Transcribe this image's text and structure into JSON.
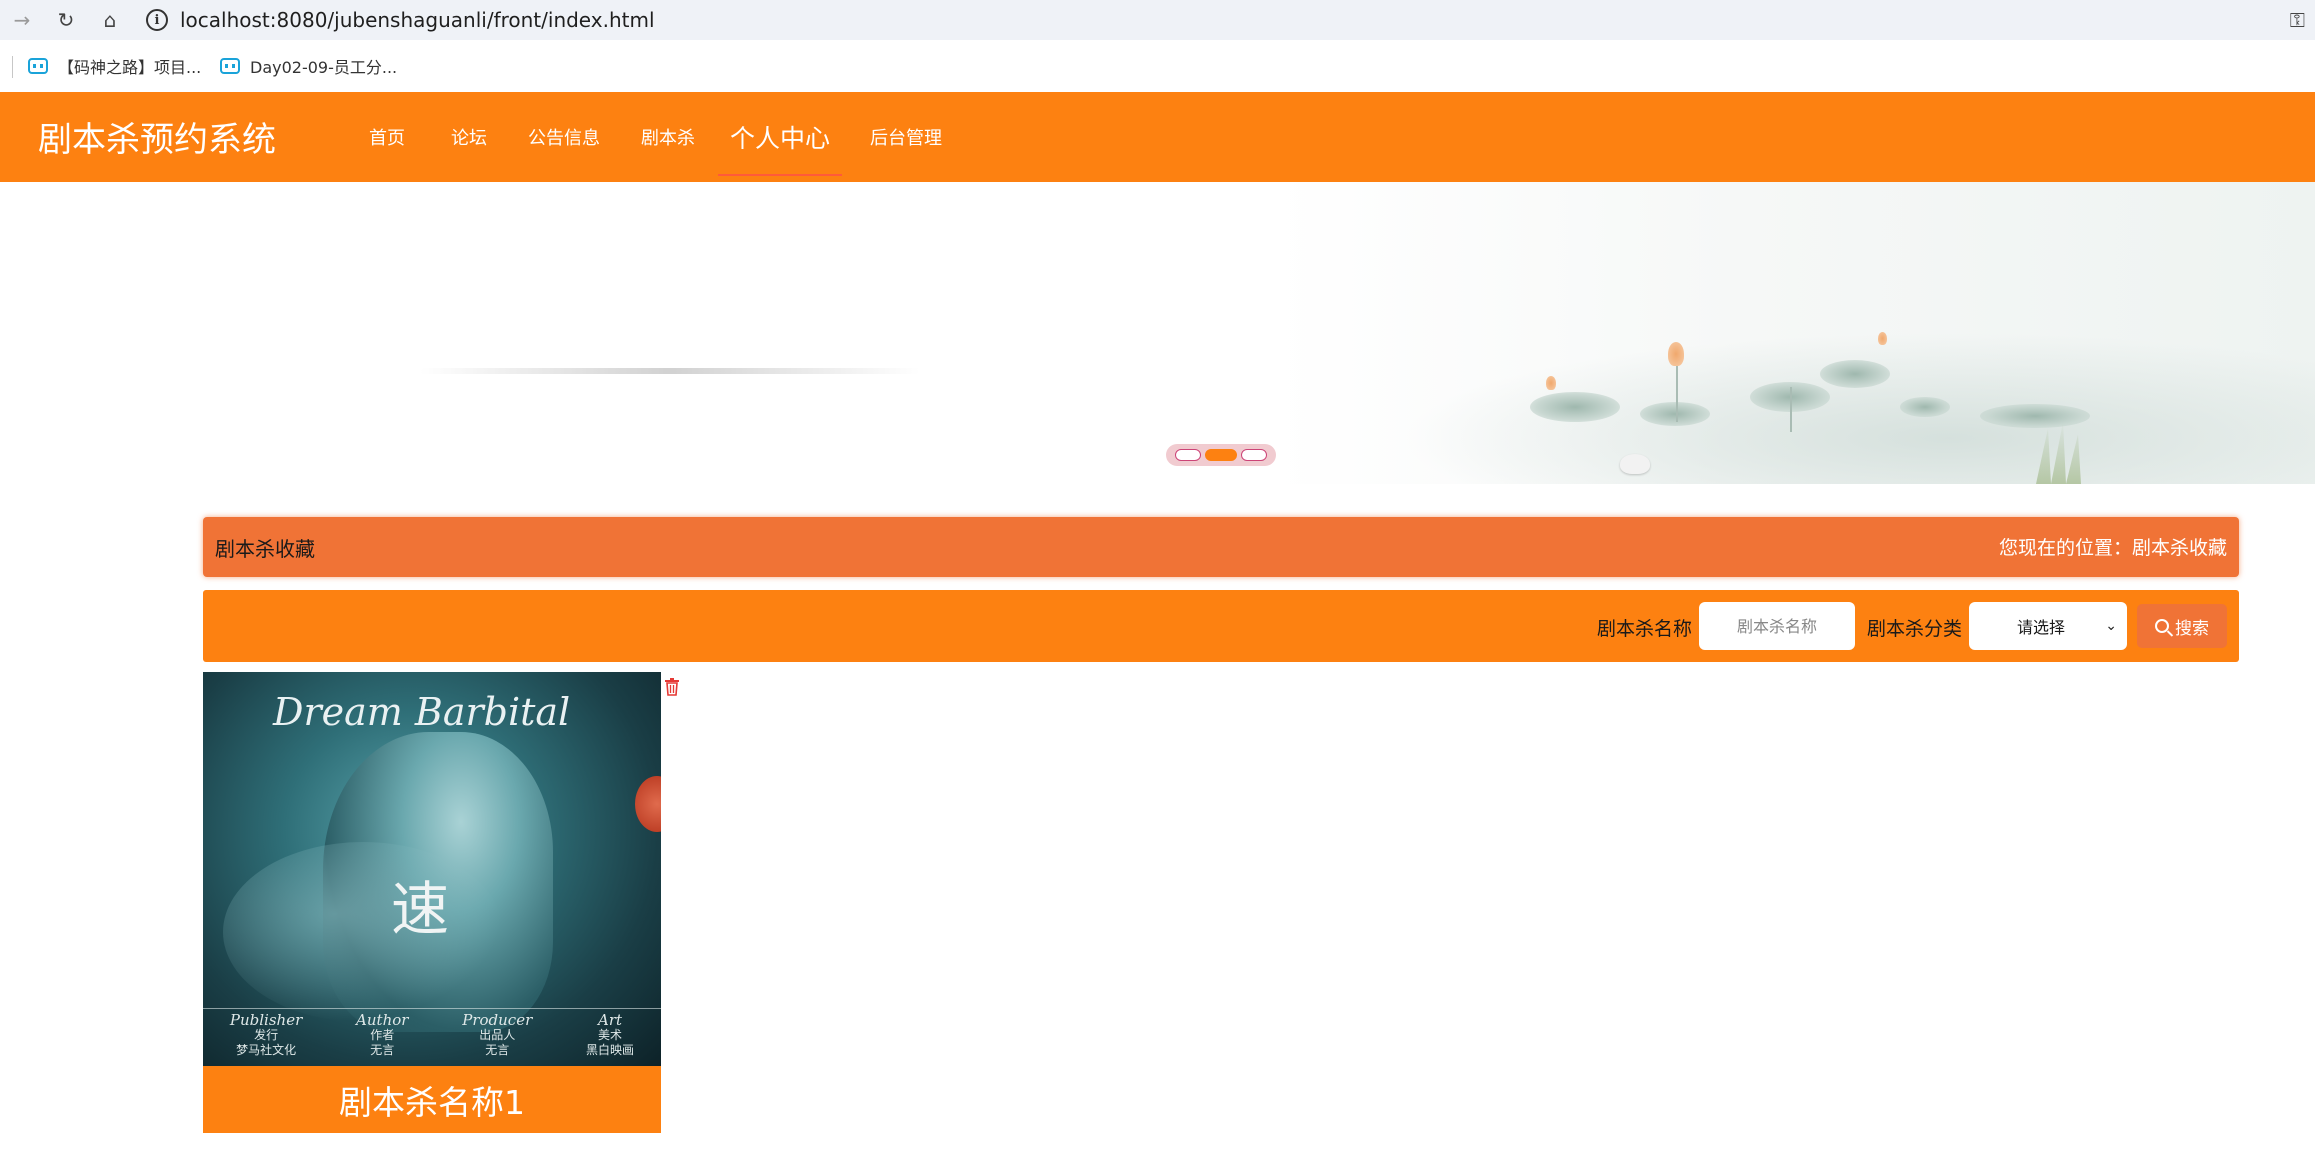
{
  "browser": {
    "url": "localhost:8080/jubenshaguanli/front/index.html",
    "bookmarks": [
      "【码神之路】项目...",
      "Day02-09-员工分..."
    ]
  },
  "header": {
    "logo": "剧本杀预约系统",
    "menu": [
      "首页",
      "论坛",
      "公告信息",
      "剧本杀",
      "个人中心",
      "后台管理"
    ],
    "active_menu": "个人中心"
  },
  "carousel": {
    "slides": 3,
    "active_index": 1
  },
  "breadcrumb": {
    "title": "剧本杀收藏",
    "location": "您现在的位置：剧本杀收藏"
  },
  "search": {
    "name_label": "剧本杀名称",
    "name_placeholder": "剧本杀名称",
    "category_label": "剧本杀分类",
    "category_selected": "请选择",
    "button_label": "搜索"
  },
  "cards": [
    {
      "name": "剧本杀名称1",
      "cover": {
        "title": "Dream Barbital",
        "glyph": "速",
        "credits": [
          {
            "en": "Publisher",
            "role": "发行",
            "value": "梦马社文化"
          },
          {
            "en": "Author",
            "role": "作者",
            "value": "无言"
          },
          {
            "en": "Producer",
            "role": "出品人",
            "value": "无言"
          },
          {
            "en": "Art",
            "role": "美术",
            "value": "黑白映画"
          }
        ]
      }
    }
  ],
  "colors": {
    "primary": "#fd8111",
    "accent": "#f07336"
  }
}
